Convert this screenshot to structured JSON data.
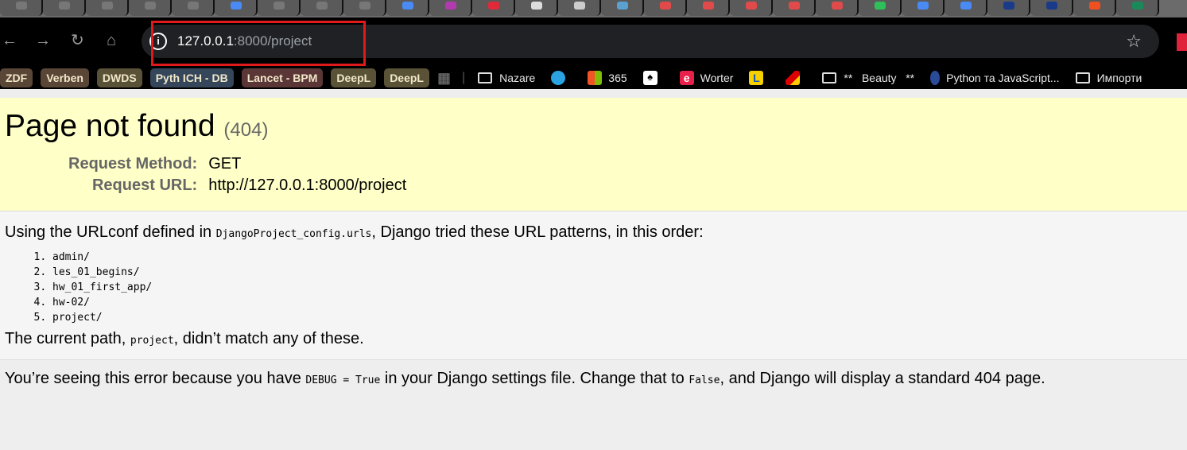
{
  "tab_strip": {
    "favicon_colors": [
      "#777",
      "#777",
      "#777",
      "#777",
      "#777",
      "#4a8af4",
      "#777",
      "#777",
      "#777",
      "#4a8af4",
      "#b23ab0",
      "#e02a3a",
      "#ddd",
      "#ccc",
      "#5aa0d0",
      "#e04a4a",
      "#e04a4a",
      "#e04a4a",
      "#e04a4a",
      "#e04a4a",
      "#2fbf5a",
      "#4a8af4",
      "#4a8af4",
      "#1a3a8a",
      "#1a3a8a",
      "#f05020",
      "#1a8a5a"
    ]
  },
  "toolbar": {
    "url_host": "127.0.0.1",
    "url_rest": ":8000/project",
    "info_icon": "i",
    "star_icon": "☆"
  },
  "bookmarks": {
    "chips": [
      {
        "label": "ZDF",
        "color": "#5a4636"
      },
      {
        "label": "Verben",
        "color": "#5a4636"
      },
      {
        "label": "DWDS",
        "color": "#5a5236"
      },
      {
        "label": "Pyth ICH - DB",
        "color": "#35455a"
      },
      {
        "label": "Lancet - BPM",
        "color": "#5a3636"
      },
      {
        "label": "DeepL",
        "color": "#5a5236"
      },
      {
        "label": "DeepL",
        "color": "#5a5236"
      }
    ],
    "items": {
      "nazare": "Nazare",
      "ms365": "365",
      "worter": "Worter",
      "beauty": "**   Beauty   **",
      "python": "Python та JavaScript...",
      "imports": "Импорти"
    }
  },
  "error": {
    "title": "Page not found",
    "code": "(404)",
    "method_label": "Request Method:",
    "method": "GET",
    "url_label": "Request URL:",
    "url": "http://127.0.0.1:8000/project",
    "urlconf_pre": "Using the URLconf defined in ",
    "urlconf_module": "DjangoProject_config.urls",
    "urlconf_post": ", Django tried these URL patterns, in this order:",
    "patterns": [
      "admin/",
      "les_01_begins/",
      "hw_01_first_app/",
      "hw-02/",
      "project/"
    ],
    "path_pre": "The current path, ",
    "path": "project",
    "path_post": ", didn’t match any of these.",
    "debug_pre": "You’re seeing this error because you have ",
    "debug_code": "DEBUG = True",
    "debug_mid": " in your Django settings file. Change that to ",
    "debug_false": "False",
    "debug_post": ", and Django will display a standard 404 page."
  }
}
